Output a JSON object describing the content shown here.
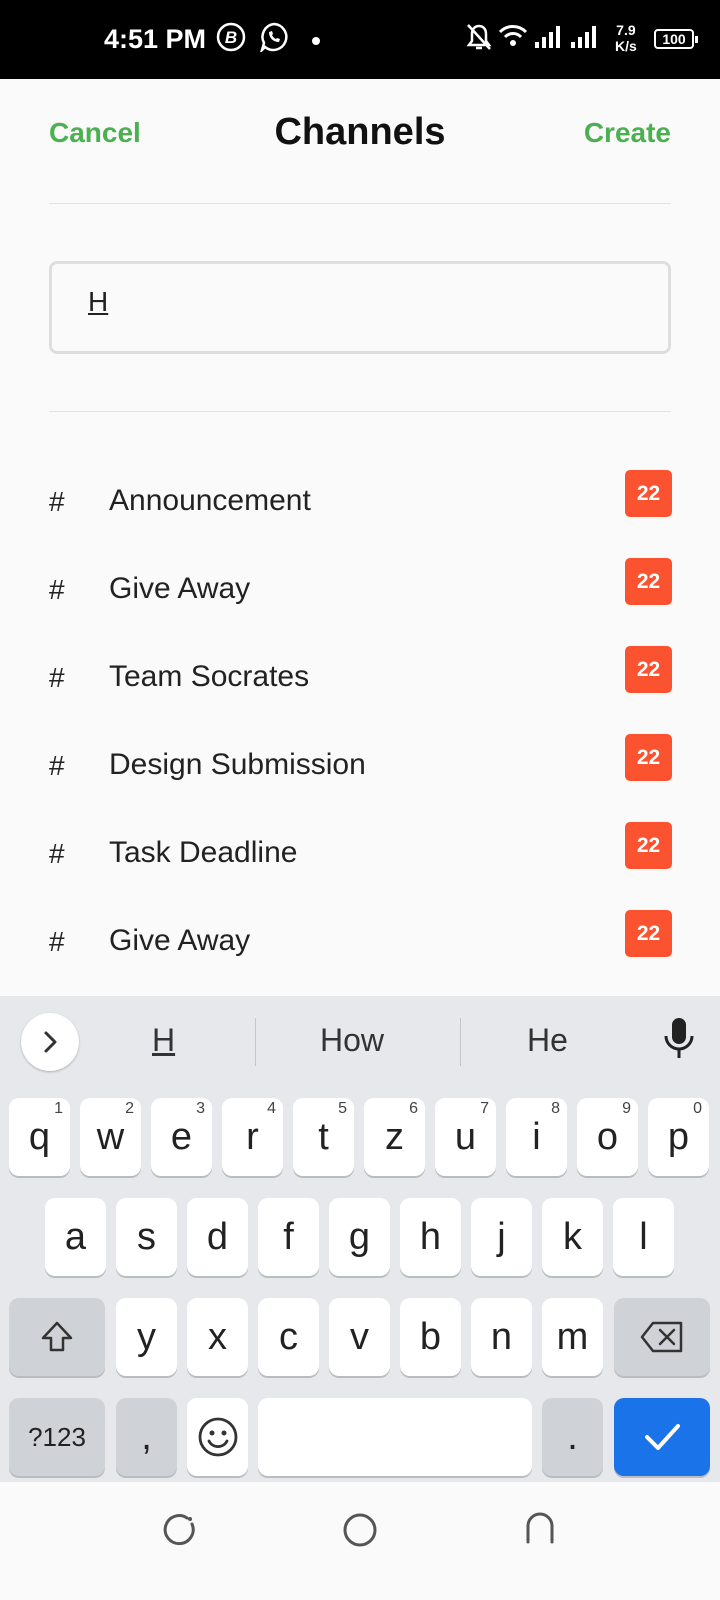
{
  "status_bar": {
    "time": "4:51 PM",
    "net_speed_value": "7.9",
    "net_speed_unit": "K/s",
    "battery": "100",
    "icons": [
      "b-app-icon",
      "whatsapp-icon",
      "dot-icon",
      "bell-off-icon",
      "wifi-icon",
      "signal-icon",
      "signal-icon-2"
    ]
  },
  "header": {
    "cancel": "Cancel",
    "title": "Channels",
    "create": "Create"
  },
  "search": {
    "value": "H"
  },
  "channels": [
    {
      "hash": "#",
      "name": "Announcement",
      "count": "22"
    },
    {
      "hash": "#",
      "name": "Give Away",
      "count": "22"
    },
    {
      "hash": "#",
      "name": "Team Socrates",
      "count": "22"
    },
    {
      "hash": "#",
      "name": "Design Submission",
      "count": "22"
    },
    {
      "hash": "#",
      "name": "Task Deadline",
      "count": "22"
    },
    {
      "hash": "#",
      "name": "Give Away",
      "count": "22"
    }
  ],
  "keyboard": {
    "suggestions": [
      "H",
      "How",
      "He"
    ],
    "row1": [
      {
        "key": "q",
        "hint": "1"
      },
      {
        "key": "w",
        "hint": "2"
      },
      {
        "key": "e",
        "hint": "3"
      },
      {
        "key": "r",
        "hint": "4"
      },
      {
        "key": "t",
        "hint": "5"
      },
      {
        "key": "z",
        "hint": "6"
      },
      {
        "key": "u",
        "hint": "7"
      },
      {
        "key": "i",
        "hint": "8"
      },
      {
        "key": "o",
        "hint": "9"
      },
      {
        "key": "p",
        "hint": "0"
      }
    ],
    "row2": [
      "a",
      "s",
      "d",
      "f",
      "g",
      "h",
      "j",
      "k",
      "l"
    ],
    "row3": [
      "y",
      "x",
      "c",
      "v",
      "b",
      "n",
      "m"
    ],
    "symbols_key": "?123",
    "comma_key": ",",
    "period_key": "."
  },
  "colors": {
    "accent": "#4caf50",
    "badge": "#fb5230",
    "enter_key": "#1a73e8"
  }
}
